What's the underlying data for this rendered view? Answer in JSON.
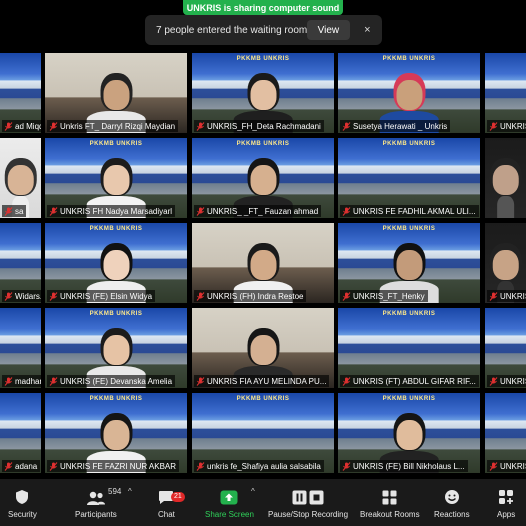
{
  "share_banner": "UNKRIS is sharing computer sound",
  "waiting_room": {
    "message": "7 people entered the waiting room",
    "view_label": "View",
    "close_glyph": "×"
  },
  "banner_text": "PKKMB UNKRIS",
  "participants": [
    "ad Miqd...",
    "Unkris FT_ Darryl Rizqi Maydian",
    "UNKRIS_FH_Deta Rachmadani",
    "Susetya Herawati _ Unkris",
    "UNKRIS_",
    "sa",
    "UNKRIS FH Nadya Marsadiyarl",
    "UNKRIS_ _FT_ Fauzan ahmad",
    "UNKRIS FE FADHIL AKMAL ULI...",
    "",
    "Widars...",
    "UNKRIS (FE) Elsin Widya",
    "UNKRIS (FH) Indra Restoe",
    "UNKRIS_FT_Henky",
    "UNKRIS_",
    "madhan",
    "UNKRIS (FE) Devanska Amelia",
    "UNKRIS FIA AYU MELINDA PU...",
    "UNKRIS (FT) ABDUL GIFAR RIF...",
    "UNKRIS_",
    "adana",
    "UNKRIS FE FAZRI NUR AKBAR",
    "unkris fe_Shafiya aulia salsabila",
    "UNKRIS (FE) Bill Nikholaus L...",
    "UNKRIS_"
  ],
  "toolbar": {
    "security": "Security",
    "participants": "Participants",
    "participants_count": "594",
    "chat": "Chat",
    "chat_badge": "21",
    "share_screen": "Share Screen",
    "pause_recording": "Pause/Stop Recording",
    "breakout_rooms": "Breakout Rooms",
    "reactions": "Reactions",
    "apps": "Apps"
  },
  "colors": {
    "share_green": "#23b14d",
    "mic_red": "#e03030",
    "toolbar_bg": "#1a1a1a"
  }
}
